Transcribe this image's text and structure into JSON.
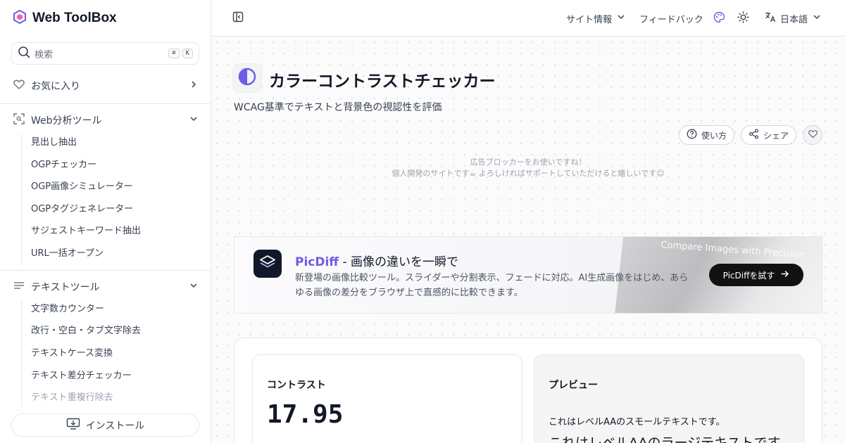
{
  "brand": {
    "name": "Web ToolBox",
    "accent": "#6d5ce7"
  },
  "sidebar": {
    "search": {
      "placeholder": "検索",
      "kbd_meta": "⌘",
      "kbd_key": "K"
    },
    "favorites": {
      "label": "お気に入り"
    },
    "groups": [
      {
        "label": "Web分析ツール",
        "icon": "scan-icon",
        "items": [
          "見出し抽出",
          "OGPチェッカー",
          "OGP画像シミュレーター",
          "OGPタグジェネレーター",
          "サジェストキーワード抽出",
          "URL一括オープン"
        ]
      },
      {
        "label": "テキストツール",
        "icon": "text-lines-icon",
        "items": [
          "文字数カウンター",
          "改行・空白・タブ文字除去",
          "テキストケース変換",
          "テキスト差分チェッカー",
          "テキスト重複行除去"
        ]
      }
    ],
    "install_label": "インストール"
  },
  "header": {
    "site_info": "サイト情報",
    "feedback": "フィードバック",
    "language": "日本語"
  },
  "page": {
    "title": "カラーコントラストチェッカー",
    "subtitle": "WCAG基準でテキストと背景色の視認性を評価",
    "howto_label": "使い方",
    "share_label": "シェア"
  },
  "ad_notice": {
    "line1": "広告ブロッカーをお使いですね！",
    "line2": "個人開発のサイトです☕ よろしければサポートしていただけると嬉しいです😊"
  },
  "promo": {
    "brand": "PicDiff",
    "title_rest": " - 画像の違いを一瞬で",
    "description": "新登場の画像比較ツール。スライダーや分割表示、フェードに対応。AI生成画像をはじめ、あらゆる画像の差分をブラウザ上で直感的に比較できます。",
    "cta": "PicDiffを試す",
    "screenshot_caption": "Compare Images with Precision"
  },
  "contrast": {
    "label": "コントラスト",
    "ratio": "17.95"
  },
  "preview": {
    "label": "プレビュー",
    "small_text": "これはレベルAAのスモールテキストです。",
    "large_text": "これはレベルAAのラージテキストです。"
  }
}
